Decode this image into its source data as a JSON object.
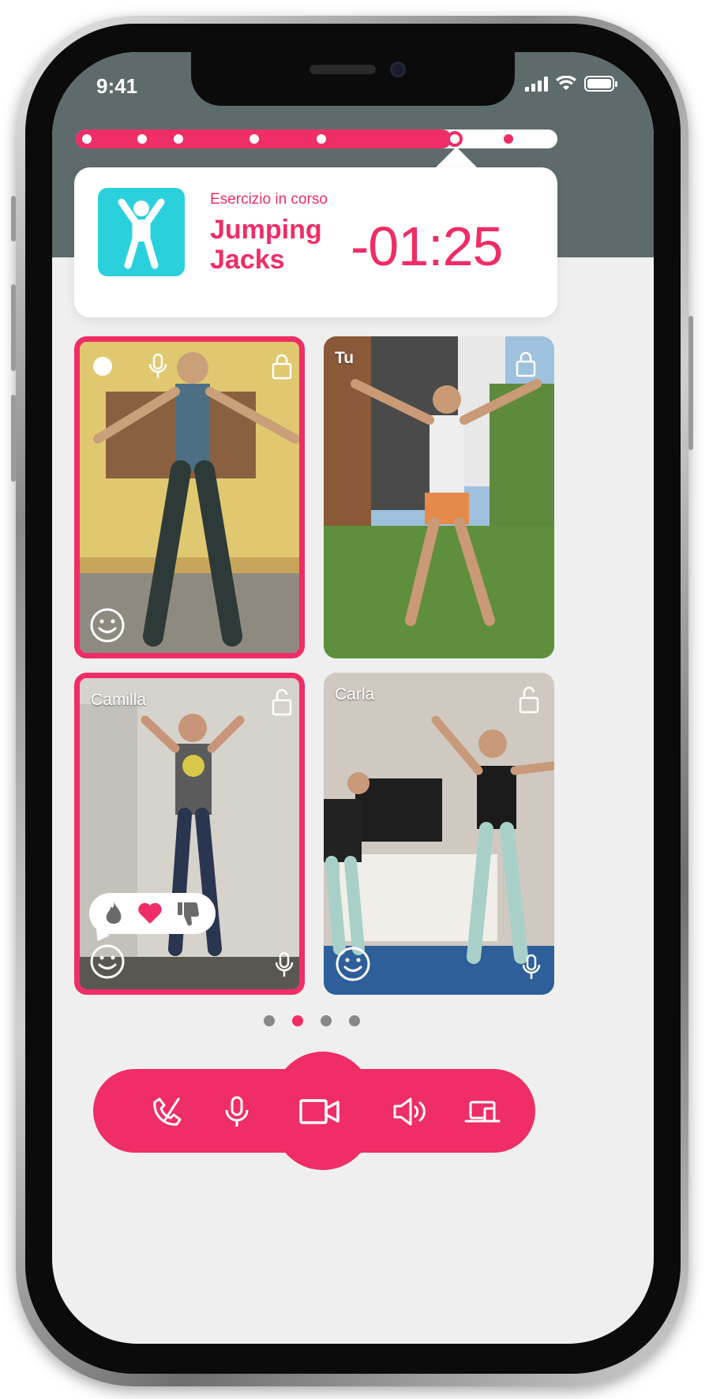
{
  "status_bar": {
    "time": "9:41"
  },
  "progress": {
    "completed_fraction": 0.78,
    "markers": 7,
    "current_marker_index": 5
  },
  "exercise": {
    "label": "Esercizio in corso",
    "name_line1": "Jumping",
    "name_line2": "Jacks",
    "timer": "-01:25",
    "icon": "jumping-person-icon"
  },
  "tiles": [
    {
      "name": "",
      "icons": [
        "camera-toggle-icon",
        "mic-icon",
        "lock-icon",
        "smile-icon"
      ],
      "active": true,
      "colors": [
        "#c7a55a",
        "#e8d27a",
        "#6b5436"
      ]
    },
    {
      "name": "Tu",
      "icons": [
        "lock-icon"
      ],
      "active": false,
      "colors": [
        "#8fb7d8",
        "#6f8f5a",
        "#4a6a32"
      ]
    },
    {
      "name": "Camilla",
      "icons": [
        "unlock-icon",
        "smile-icon",
        "mic-icon"
      ],
      "active": true,
      "colors": [
        "#d9d5d0",
        "#bdb6ad",
        "#5a5650"
      ],
      "reactions": [
        "fire-icon",
        "heart-icon",
        "thumbs-down-icon"
      ]
    },
    {
      "name": "Carla",
      "icons": [
        "unlock-icon",
        "smile-icon",
        "mic-icon"
      ],
      "active": false,
      "colors": [
        "#c9c3bb",
        "#e6e1da",
        "#2e5f9a"
      ]
    }
  ],
  "pagination": {
    "count": 4,
    "active_index": 1
  },
  "call_bar": {
    "buttons": [
      "end-call-icon",
      "mic-icon",
      "video-camera-icon",
      "speaker-icon",
      "screen-share-icon"
    ]
  },
  "colors": {
    "accent": "#ef2d66",
    "teal": "#2ad1dd",
    "header": "#5e6b6c"
  }
}
